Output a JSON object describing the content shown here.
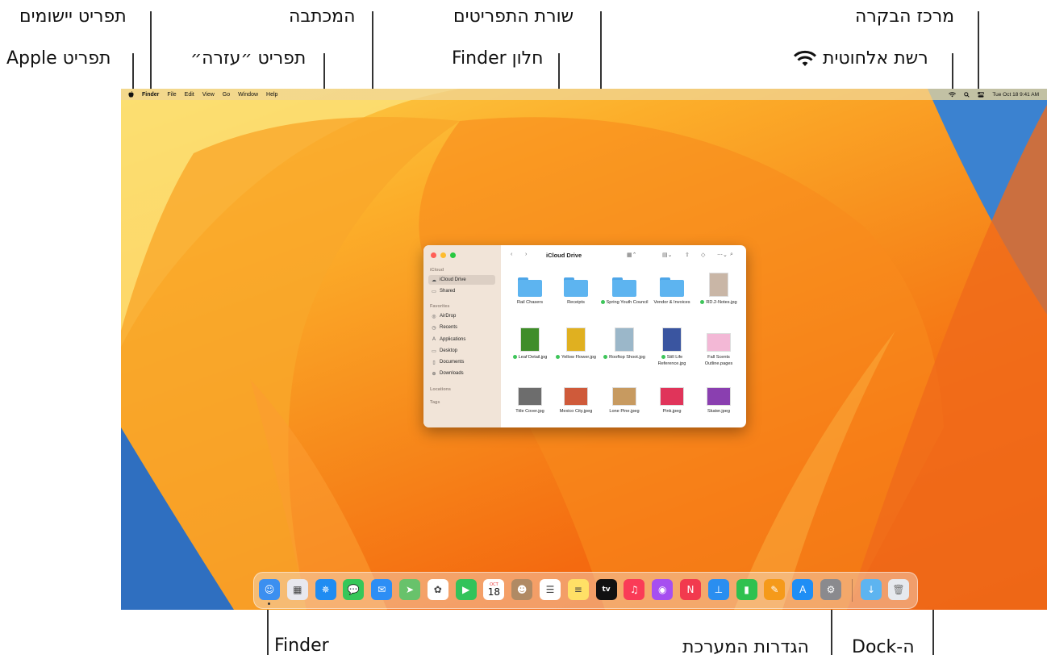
{
  "callouts": {
    "apps_menu": "תפריט יישומים",
    "desktop": "המכתבה",
    "menu_bar": "שורת התפריטים",
    "control_center": "מרכז הבקרה",
    "apple_menu": "תפריט Apple",
    "help_menu": "תפריט ״עזרה״",
    "finder_window": "חלון Finder",
    "wifi": "רשת אלחוטית",
    "finder": "Finder",
    "system_settings": "הגדרות המערכת",
    "dock": "ה-Dock"
  },
  "menubar": {
    "apple": "",
    "items": [
      "Finder",
      "File",
      "Edit",
      "View",
      "Go",
      "Window",
      "Help"
    ],
    "status": {
      "wifi_icon": "wifi-icon",
      "search_icon": "search-icon",
      "control_center_icon": "control-center-icon",
      "datetime": "Tue Oct 18  9:41 AM"
    }
  },
  "finder": {
    "title": "iCloud Drive",
    "sidebar": {
      "sections": [
        {
          "label": "iCloud",
          "items": [
            {
              "label": "iCloud Drive",
              "icon": "cloud-icon",
              "selected": true
            },
            {
              "label": "Shared",
              "icon": "shared-folder-icon"
            }
          ]
        },
        {
          "label": "Favorites",
          "items": [
            {
              "label": "AirDrop",
              "icon": "airdrop-icon"
            },
            {
              "label": "Recents",
              "icon": "clock-icon"
            },
            {
              "label": "Applications",
              "icon": "applications-icon"
            },
            {
              "label": "Desktop",
              "icon": "desktop-icon"
            },
            {
              "label": "Documents",
              "icon": "document-icon"
            },
            {
              "label": "Downloads",
              "icon": "download-icon"
            }
          ]
        },
        {
          "label": "Locations",
          "items": []
        },
        {
          "label": "Tags",
          "items": []
        }
      ]
    },
    "files": [
      {
        "name": "Rail Chasers",
        "kind": "folder",
        "tag": false
      },
      {
        "name": "Receipts",
        "kind": "folder",
        "tag": false
      },
      {
        "name": "Spring Youth Council",
        "kind": "folder",
        "tag": true
      },
      {
        "name": "Vendor & Invoices",
        "kind": "folder",
        "tag": false
      },
      {
        "name": "RD.2-Notes.jpg",
        "kind": "image",
        "tag": true,
        "color": "#c9b6a6"
      },
      {
        "name": "Leaf Detail.jpg",
        "kind": "image",
        "tag": true,
        "color": "#3f8d2a"
      },
      {
        "name": "Yellow Flower.jpg",
        "kind": "image",
        "tag": true,
        "color": "#e0b020"
      },
      {
        "name": "Rooftop Shoot.jpg",
        "kind": "image",
        "tag": true,
        "color": "#9bb7c9"
      },
      {
        "name": "Still Life Reference.jpg",
        "kind": "image",
        "tag": true,
        "color": "#3a55a0"
      },
      {
        "name": "Fall Scents Outline.pages",
        "kind": "doc",
        "tag": false,
        "color": "#f3b8d6"
      },
      {
        "name": "Title Cover.jpg",
        "kind": "image",
        "tag": false,
        "color": "#6d6d6d"
      },
      {
        "name": "Mexico City.jpeg",
        "kind": "image",
        "tag": false,
        "color": "#cf5a3a"
      },
      {
        "name": "Lone Pine.jpeg",
        "kind": "image",
        "tag": false,
        "color": "#c79a60"
      },
      {
        "name": "Pink.jpeg",
        "kind": "image",
        "tag": false,
        "color": "#e0345a"
      },
      {
        "name": "Skater.jpeg",
        "kind": "image",
        "tag": false,
        "color": "#8a3fb0"
      }
    ]
  },
  "dock": {
    "calendar_month": "OCT",
    "calendar_day": "18",
    "tv_label": "tv",
    "apps": [
      {
        "name": "finder-icon",
        "color": "#3b8ff0",
        "glyph": "☺"
      },
      {
        "name": "launchpad-icon",
        "color": "#e8e8ee",
        "glyph": "▦"
      },
      {
        "name": "safari-icon",
        "color": "#1f8cf2",
        "glyph": "✵"
      },
      {
        "name": "messages-icon",
        "color": "#35c759",
        "glyph": "💬"
      },
      {
        "name": "mail-icon",
        "color": "#2d8ef5",
        "glyph": "✉"
      },
      {
        "name": "maps-icon",
        "color": "#68c26b",
        "glyph": "➤"
      },
      {
        "name": "photos-icon",
        "color": "#ffffff",
        "glyph": "✿"
      },
      {
        "name": "facetime-icon",
        "color": "#32c35a",
        "glyph": "▶"
      },
      {
        "name": "calendar-icon",
        "color": "#ffffff",
        "glyph": ""
      },
      {
        "name": "contacts-icon",
        "color": "#b08a64",
        "glyph": "☻"
      },
      {
        "name": "reminders-icon",
        "color": "#ffffff",
        "glyph": "☰"
      },
      {
        "name": "notes-icon",
        "color": "#ffe066",
        "glyph": "≡"
      },
      {
        "name": "apple-tv-icon",
        "color": "#111111",
        "glyph": ""
      },
      {
        "name": "music-icon",
        "color": "#fa3b57",
        "glyph": "♫"
      },
      {
        "name": "podcasts-icon",
        "color": "#a64ff0",
        "glyph": "◉"
      },
      {
        "name": "news-icon",
        "color": "#f23a4e",
        "glyph": "N"
      },
      {
        "name": "keynote-icon",
        "color": "#2a8ef0",
        "glyph": "⊥"
      },
      {
        "name": "numbers-icon",
        "color": "#2fc14f",
        "glyph": "▮"
      },
      {
        "name": "pages-icon",
        "color": "#f59a1a",
        "glyph": "✎"
      },
      {
        "name": "app-store-icon",
        "color": "#1f8ef5",
        "glyph": "A"
      },
      {
        "name": "system-settings-icon",
        "color": "#8a8a8e",
        "glyph": "⚙"
      }
    ],
    "extras": [
      {
        "name": "downloads-folder-icon",
        "color": "#5db4f0",
        "glyph": "↓"
      },
      {
        "name": "trash-icon",
        "color": "#e6e9ee",
        "glyph": "🗑"
      }
    ]
  }
}
